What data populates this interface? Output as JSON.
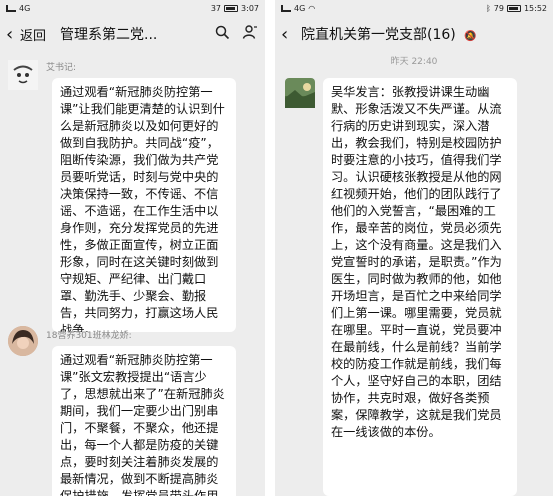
{
  "left": {
    "status": {
      "signal": "4G",
      "battery": "37",
      "time": "3:07"
    },
    "header": {
      "back_label": "返回",
      "title": "管理系第二党...",
      "search_icon": "search-icon",
      "people_icon": "person-icon"
    },
    "messages": [
      {
        "sender": "艾书记:",
        "text": "通过观看“新冠肺炎防控第一课”让我们能更清楚的认识到什么是新冠肺炎以及如何更好的做到自我防护。共同战“疫”，阻断传染源，我们做为共产党员要听党话，时刻与党中央的决策保持一致，不传谣、不信谣、不造谣，在工作生活中以身作则，充分发挥党员的先进性，多做正面宣传，树立正面形象，同时在这关键时刻做到守规矩、严纪律、出门戴口罩、勤洗手、少聚会、勤报告，共同努力，打赢这场人民战争。"
      },
      {
        "sender": "18营养301班林龙娇:",
        "text": "通过观看“新冠肺炎防控第一课”张文宏教授提出“语言少了，思想就出来了”在新冠肺炎期间，我们一定要少出门别串门，不聚餐，不聚众，他还提出，每一个人都是防疫的关键点，要时刻关注着肺炎发展的最新情况，做到不断提高肺炎保护措施，发挥党员带头作用向周围人宣传防疫知识，与祖"
      }
    ]
  },
  "right": {
    "status": {
      "signal": "4G",
      "battery": "79",
      "time": "15:52"
    },
    "header": {
      "title": "院直机关第一党支部(16)",
      "mute_icon": "bell-icon"
    },
    "timestamp": "昨天 22:40",
    "messages": [
      {
        "text": "吴华发言：张教授讲课生动幽默、形象活泼又不失严谨。从流行病的历史讲到现实，深入潜出，教会我们，特别是校园防护时要注意的小技巧，值得我们学习。认识硬核张教授是从他的网红视频开始，他们的团队践行了他们的入党誓言，“最困难的工作，最辛苦的岗位，党员必须先上，这个没有商量。这是我们入党宣誓时的承诺，是职责。”作为医生，同时做为教师的他，如他开场坦言，是百忙之中来给同学们上第一课。哪里需要，党员就在哪里。平时一直说，党员要冲在最前线，什么是前线？当前学校的防疫工作就是前线，我们每个人，坚守好自己的本职，团结协作，共克时艰，做好各类预案，保障教学，这就是我们党员在一线该做的本份。"
      }
    ]
  },
  "colors": {
    "bubble": "#ffffff",
    "background": "#ededed",
    "accent_text": "#111111"
  }
}
